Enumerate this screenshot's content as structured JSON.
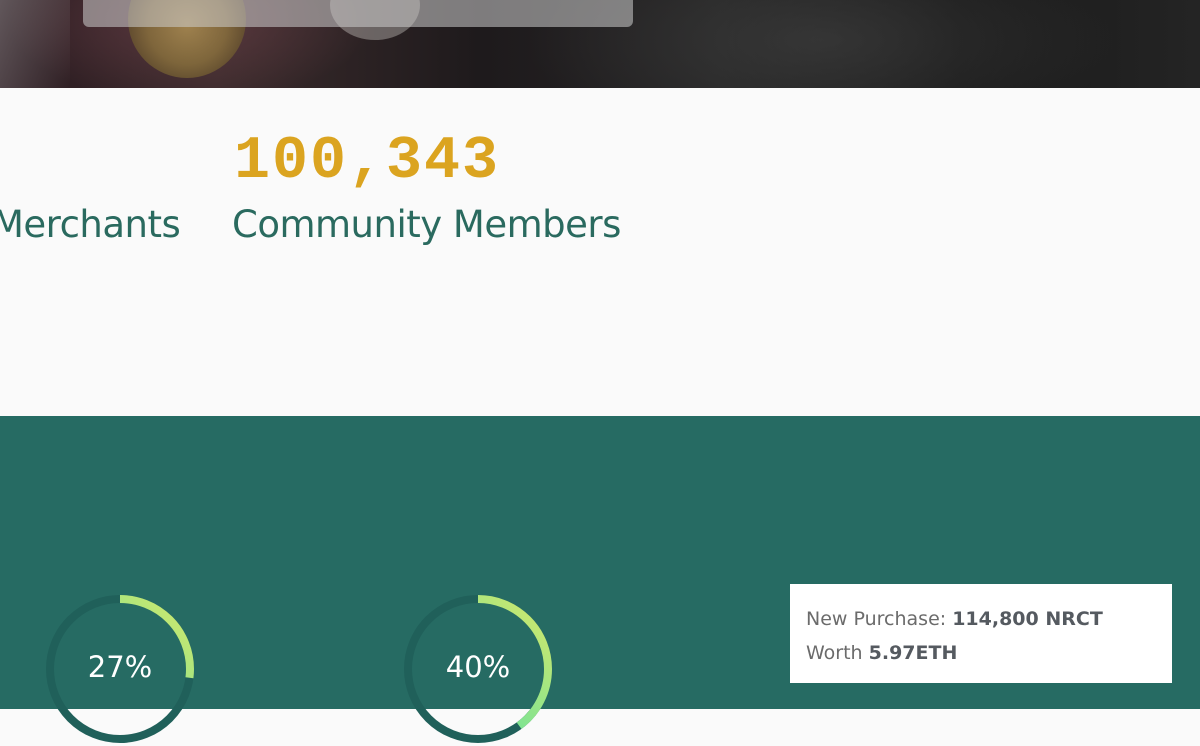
{
  "stats": {
    "merchants_label": "Merchants",
    "community_value": "100,343",
    "community_label": "Community Members"
  },
  "progress": {
    "rings": [
      {
        "label": "27%",
        "value": 0.27
      },
      {
        "label": "40%",
        "value": 0.4
      }
    ]
  },
  "purchase": {
    "prefix": "New Purchase: ",
    "amount": "114,800 NRCT",
    "worth_prefix": "Worth ",
    "worth": "5.97ETH"
  },
  "colors": {
    "accent_gold": "#dba420",
    "teal": "#266b63",
    "label_teal": "#2a6a5f",
    "ring_start": "#3ee0b0",
    "ring_end": "#d6e86a"
  }
}
